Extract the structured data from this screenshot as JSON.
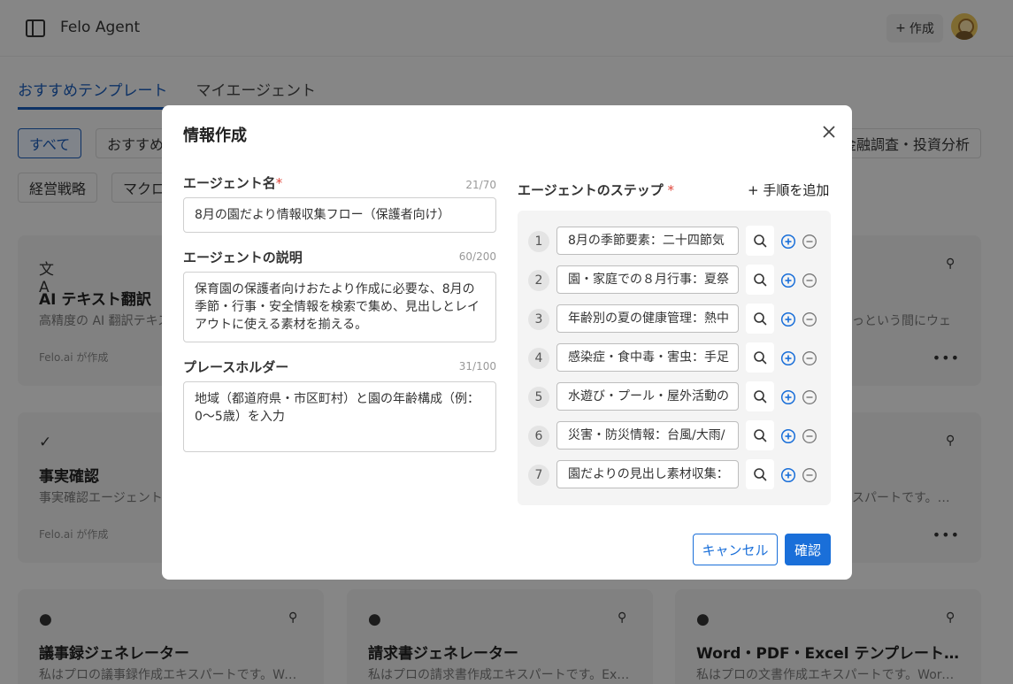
{
  "header": {
    "app_title": "Felo Agent",
    "create_label": "作成"
  },
  "tabs": [
    {
      "label": "おすすめテンプレート",
      "active": true
    },
    {
      "label": "マイエージェント",
      "active": false
    }
  ],
  "filters": {
    "all": "すべて",
    "recommended": "おすすめ",
    "finance": "金融調査・投資分析",
    "management": "経営戦略",
    "macro": "マクロ"
  },
  "cards": {
    "translate": {
      "title": "AI テキスト翻訳",
      "desc": "高精度の AI 翻訳テキス",
      "author": "Felo.ai が作成"
    },
    "web": {
      "desc": "っという間にウェ"
    },
    "factcheck": {
      "title": "事実確認",
      "desc": "事実確認エージェント",
      "author": "Felo.ai が作成"
    },
    "web2": {
      "desc": "スパートです。Wo…"
    },
    "minutes": {
      "title": "議事録ジェネレーター",
      "desc": "私はプロの議事録作成エキスパートです。Wo…"
    },
    "invoice": {
      "title": "請求書ジェネレーター",
      "desc": "私はプロの請求書作成エキスパートです。Ex…"
    },
    "docs": {
      "title": "Word・PDF・Excel テンプレート文書…",
      "desc": "私はプロの文書作成エキスパートです。Word…"
    }
  },
  "modal": {
    "title": "情報作成",
    "name_label": "エージェント名",
    "name_counter": "21/70",
    "name_value": "8月の園だより情報収集フロー（保護者向け）",
    "desc_label": "エージェントの説明",
    "desc_counter": "60/200",
    "desc_value": "保育園の保護者向けおたより作成に必要な、8月の季節・行事・安全情報を検索で集め、見出しとレイアウトに使える素材を揃える。",
    "placeholder_label": "プレースホルダー",
    "placeholder_counter": "31/100",
    "placeholder_value": "地域（都道府県・市区町村）と園の年齢構成（例：0〜5歳）を入力",
    "steps_label": "エージェントのステップ",
    "add_step_label": "+ 手順を追加",
    "steps": [
      {
        "num": "1",
        "text": "8月の季節要素：二十四節気"
      },
      {
        "num": "2",
        "text": "園・家庭での８月行事：夏祭"
      },
      {
        "num": "3",
        "text": "年齢別の夏の健康管理：熱中"
      },
      {
        "num": "4",
        "text": "感染症・食中毒・害虫：手足"
      },
      {
        "num": "5",
        "text": "水遊び・プール・屋外活動の"
      },
      {
        "num": "6",
        "text": "災害・防災情報：台風/大雨/"
      },
      {
        "num": "7",
        "text": "園だよりの見出し素材収集："
      }
    ],
    "cancel_label": "キャンセル",
    "confirm_label": "確認"
  },
  "colors": {
    "accent": "#1a6fd9",
    "required": "#e0463b"
  }
}
